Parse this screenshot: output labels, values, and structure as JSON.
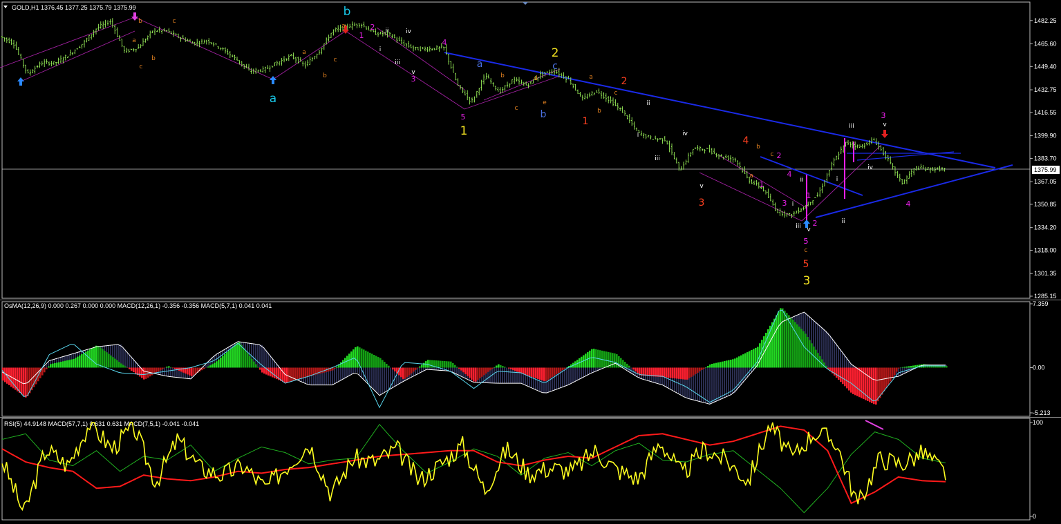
{
  "panels": {
    "price": {
      "header": "GOLD,H1  1376.45 1377.25 1375.79 1375.99",
      "current_price": "1375.99",
      "y_ticks": [
        "1482.25",
        "1465.60",
        "1449.40",
        "1432.75",
        "1416.55",
        "1399.90",
        "1383.70",
        "1367.05",
        "1350.85",
        "1334.20",
        "1318.00",
        "1301.35",
        "1285.15"
      ]
    },
    "osma": {
      "header": "OsMA(12,26,9) 0.000 0.267 0.000 0.000  MACD(12,26,1) -0.356 -0.356  MACD(5,7,1) 0.041 0.041",
      "y_ticks": [
        "7.359",
        "0.00",
        "-5.213"
      ]
    },
    "rsi": {
      "header": "RSI(5) 44.9148  MACD(57,7,1) 0.631 0.631  MACD(7,5,1) -0.041 -0.041",
      "y_ticks": [
        "100",
        "0"
      ]
    }
  },
  "wave_labels": [
    {
      "text": "b",
      "color": "#18c8e8",
      "size": "big"
    },
    {
      "text": "a",
      "color": "#18c8e8",
      "size": "big"
    },
    {
      "text": "2",
      "color": "#f0e020",
      "size": "big"
    },
    {
      "text": "1",
      "color": "#f0e020",
      "size": "big"
    },
    {
      "text": "3",
      "color": "#f0e020",
      "size": "big"
    },
    {
      "text": "a",
      "color": "#4a70e0",
      "size": "mid"
    },
    {
      "text": "c",
      "color": "#4a70e0",
      "size": "mid"
    },
    {
      "text": "b",
      "color": "#4a70e0",
      "size": "mid"
    },
    {
      "text": "2",
      "color": "#ff4020",
      "size": "mid"
    },
    {
      "text": "1",
      "color": "#ff4020",
      "size": "mid"
    },
    {
      "text": "3",
      "color": "#ff4020",
      "size": "mid"
    },
    {
      "text": "4",
      "color": "#ff4020",
      "size": "mid"
    },
    {
      "text": "5",
      "color": "#ff4020",
      "size": "mid"
    },
    {
      "text": "1",
      "color": "#e020e0",
      "size": "small"
    },
    {
      "text": "2",
      "color": "#e020e0",
      "size": "small"
    },
    {
      "text": "3",
      "color": "#e020e0",
      "size": "small"
    },
    {
      "text": "4",
      "color": "#e020e0",
      "size": "small"
    },
    {
      "text": "5",
      "color": "#e020e0",
      "size": "small"
    },
    {
      "text": "1",
      "color": "#e020e0",
      "size": "small"
    },
    {
      "text": "2",
      "color": "#e020e0",
      "size": "small"
    },
    {
      "text": "4",
      "color": "#e020e0",
      "size": "small"
    },
    {
      "text": "3",
      "color": "#e020e0",
      "size": "small"
    },
    {
      "text": "1",
      "color": "#e020e0",
      "size": "small"
    },
    {
      "text": "2",
      "color": "#e020e0",
      "size": "small"
    },
    {
      "text": "5",
      "color": "#e020e0",
      "size": "small"
    },
    {
      "text": "3",
      "color": "#e020e0",
      "size": "small"
    },
    {
      "text": "4",
      "color": "#e020e0",
      "size": "small"
    },
    {
      "text": "b",
      "color": "#e08020",
      "size": "tiny"
    },
    {
      "text": "a",
      "color": "#e08020",
      "size": "tiny"
    },
    {
      "text": "c",
      "color": "#e08020",
      "size": "tiny"
    },
    {
      "text": "b",
      "color": "#e08020",
      "size": "tiny"
    },
    {
      "text": "c",
      "color": "#e08020",
      "size": "tiny"
    },
    {
      "text": "a",
      "color": "#e08020",
      "size": "tiny"
    },
    {
      "text": "b",
      "color": "#e08020",
      "size": "tiny"
    },
    {
      "text": "c",
      "color": "#e08020",
      "size": "tiny"
    },
    {
      "text": "a",
      "color": "#e08020",
      "size": "tiny"
    },
    {
      "text": "b",
      "color": "#e08020",
      "size": "tiny"
    },
    {
      "text": "c",
      "color": "#e08020",
      "size": "tiny"
    },
    {
      "text": "d",
      "color": "#e08020",
      "size": "tiny"
    },
    {
      "text": "e",
      "color": "#e08020",
      "size": "tiny"
    },
    {
      "text": "a",
      "color": "#e08020",
      "size": "tiny"
    },
    {
      "text": "b",
      "color": "#e08020",
      "size": "tiny"
    },
    {
      "text": "c",
      "color": "#e08020",
      "size": "tiny"
    },
    {
      "text": "a",
      "color": "#e08020",
      "size": "tiny"
    },
    {
      "text": "b",
      "color": "#e08020",
      "size": "tiny"
    },
    {
      "text": "c",
      "color": "#e08020",
      "size": "tiny"
    },
    {
      "text": "i",
      "color": "#ffffff",
      "size": "tiny"
    },
    {
      "text": "ii",
      "color": "#ffffff",
      "size": "tiny"
    },
    {
      "text": "iii",
      "color": "#ffffff",
      "size": "tiny"
    },
    {
      "text": "iv",
      "color": "#ffffff",
      "size": "tiny"
    },
    {
      "text": "v",
      "color": "#ffffff",
      "size": "tiny"
    },
    {
      "text": "ii",
      "color": "#ffffff",
      "size": "tiny"
    },
    {
      "text": "i",
      "color": "#ffffff",
      "size": "tiny"
    },
    {
      "text": "iii",
      "color": "#ffffff",
      "size": "tiny"
    },
    {
      "text": "iv",
      "color": "#ffffff",
      "size": "tiny"
    },
    {
      "text": "v",
      "color": "#ffffff",
      "size": "tiny"
    },
    {
      "text": "ii",
      "color": "#ffffff",
      "size": "tiny"
    },
    {
      "text": "i",
      "color": "#ffffff",
      "size": "tiny"
    },
    {
      "text": "iii",
      "color": "#ffffff",
      "size": "tiny"
    },
    {
      "text": "v",
      "color": "#ffffff",
      "size": "tiny"
    },
    {
      "text": "i",
      "color": "#ffffff",
      "size": "tiny"
    },
    {
      "text": "ii",
      "color": "#ffffff",
      "size": "tiny"
    },
    {
      "text": "iii",
      "color": "#ffffff",
      "size": "tiny"
    },
    {
      "text": "iv",
      "color": "#ffffff",
      "size": "tiny"
    },
    {
      "text": "v",
      "color": "#ffffff",
      "size": "tiny"
    },
    {
      "text": "3",
      "color": "#e020e0",
      "size": "small"
    },
    {
      "text": "5",
      "color": "#e020e0",
      "size": "small"
    },
    {
      "text": "c",
      "color": "#e08020",
      "size": "tiny"
    }
  ],
  "chart_data": [
    {
      "type": "line",
      "title": "GOLD,H1",
      "series": [
        {
          "values": [
            1471,
            1466,
            1444,
            1452,
            1452,
            1458,
            1466,
            1477,
            1482,
            1460,
            1463,
            1475,
            1475,
            1470,
            1466,
            1468,
            1462,
            1455,
            1446,
            1447,
            1452,
            1457,
            1450,
            1460,
            1475,
            1478,
            1480,
            1473,
            1473,
            1466,
            1462,
            1462,
            1463,
            1436,
            1424,
            1443,
            1431,
            1440,
            1436,
            1444,
            1446,
            1440,
            1426,
            1432,
            1425,
            1416,
            1402,
            1398,
            1397,
            1375,
            1391,
            1390,
            1385,
            1383,
            1368,
            1362,
            1346,
            1343,
            1349,
            1358,
            1380,
            1395,
            1392,
            1397,
            1383,
            1366,
            1377,
            1376,
            1376
          ]
        }
      ],
      "ylim": [
        1285.15,
        1494
      ]
    },
    {
      "type": "bar",
      "title": "OsMA(12,26,9)",
      "series": [
        {
          "name": "OsMA(12,26,9)",
          "values": [
            -1.5,
            -3.5,
            0.4,
            1.0,
            2.6,
            0.5,
            -1.4,
            0.2,
            -1.0,
            0.6,
            3.0,
            -0.6,
            -1.8,
            -1.0,
            -0.3,
            2.5,
            1.1,
            -1.4,
            0.9,
            0.7,
            -1.7,
            0.4,
            -0.7,
            -1.6,
            0.2,
            2.2,
            1.6,
            -0.9,
            -1.1,
            -1.4,
            0.4,
            1.0,
            2.4,
            7.0,
            4.0,
            -0.2,
            -3.0,
            -4.3,
            0.0,
            0.4,
            0.2
          ]
        },
        {
          "name": "MACD(12,26,1)",
          "values": [
            -0.5,
            -2.0,
            0.8,
            1.6,
            2.4,
            2.7,
            -0.4,
            -1.0,
            -1.3,
            1.4,
            3.0,
            2.6,
            -0.8,
            -2.0,
            -2.0,
            -0.5,
            -3.2,
            -1.6,
            -0.2,
            -0.4,
            -1.7,
            -1.8,
            -1.8,
            -3.0,
            -2.0,
            -0.6,
            0.5,
            -1.2,
            -2.0,
            -3.5,
            -4.2,
            -3.0,
            0.2,
            5.2,
            6.4,
            4.0,
            0.4,
            -1.5,
            -1.0,
            0.3,
            0.3
          ]
        },
        {
          "name": "MACD(5,7,1)",
          "values": [
            -0.3,
            -3.6,
            1.5,
            2.8,
            0.4,
            -0.6,
            -0.8,
            -0.4,
            0.0,
            0.8,
            2.8,
            0.3,
            -1.8,
            -1.0,
            0.0,
            1.2,
            -4.6,
            0.6,
            0.4,
            -0.4,
            -2.4,
            -0.4,
            -0.6,
            -1.8,
            0.0,
            1.2,
            0.6,
            -0.8,
            -1.0,
            -2.2,
            -4.0,
            -2.6,
            0.6,
            7.0,
            2.4,
            -0.2,
            -1.8,
            -4.0,
            -0.6,
            0.2,
            0.2
          ]
        }
      ],
      "ylim": [
        -5.213,
        7.359
      ]
    },
    {
      "type": "line",
      "title": "RSI(5)",
      "series": [
        {
          "name": "RSI(5)",
          "values": [
            60,
            3,
            72,
            54,
            100,
            72,
            96,
            36,
            82,
            52,
            44,
            54,
            30,
            54,
            78,
            24,
            62,
            58,
            72,
            38,
            56,
            76,
            28,
            72,
            46,
            52,
            48,
            70,
            50,
            40,
            80,
            44,
            72,
            60,
            38,
            98,
            62,
            90,
            80,
            12,
            62,
            56,
            68,
            46
          ]
        },
        {
          "name": "MACD(57,7,1)",
          "values": [
            72,
            58,
            52,
            48,
            30,
            32,
            44,
            40,
            38,
            42,
            48,
            46,
            50,
            52,
            56,
            60,
            64,
            66,
            68,
            70,
            70,
            58,
            54,
            60,
            64,
            62,
            74,
            86,
            88,
            82,
            76,
            80,
            88,
            96,
            92,
            70,
            14,
            26,
            42,
            38,
            37
          ]
        },
        {
          "name": "MACD(7,5,1)",
          "values": [
            82,
            88,
            60,
            54,
            70,
            48,
            64,
            60,
            76,
            48,
            62,
            74,
            68,
            56,
            60,
            62,
            98,
            70,
            46,
            58,
            72,
            64,
            44,
            62,
            68,
            54,
            70,
            78,
            60,
            58,
            66,
            70,
            50,
            30,
            4,
            30,
            66,
            90,
            82,
            62,
            57
          ]
        }
      ],
      "ylim": [
        0,
        100
      ]
    }
  ]
}
